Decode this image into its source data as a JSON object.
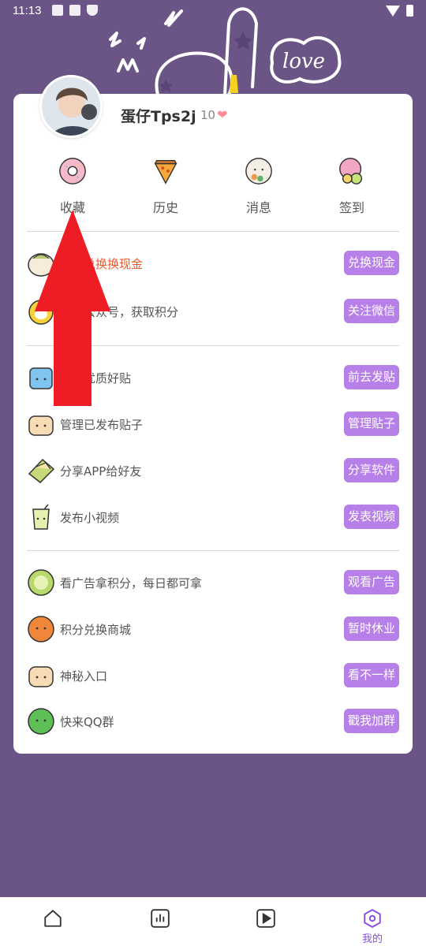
{
  "status_bar": {
    "time": "11:13"
  },
  "profile": {
    "username": "蛋仔Tps2j",
    "points": "10"
  },
  "quick_actions": [
    {
      "label": "收藏",
      "icon": "donut-icon"
    },
    {
      "label": "历史",
      "icon": "pizza-icon"
    },
    {
      "label": "消息",
      "icon": "sushi-icon"
    },
    {
      "label": "签到",
      "icon": "mochi-icon"
    }
  ],
  "group1": [
    {
      "text": "硬币兑换换现金",
      "button": "兑换现金",
      "icon": "bun-icon"
    },
    {
      "text": "微信公众号，获取积分",
      "button": "关注微信",
      "icon": "egg-icon"
    }
  ],
  "group2": [
    {
      "text": "子发优质好贴",
      "button": "前去发贴",
      "icon": "ice-cube-icon"
    },
    {
      "text": "管理已发布贴子",
      "button": "管理贴子",
      "icon": "cake-icon"
    },
    {
      "text": "分享APP给好友",
      "button": "分享软件",
      "icon": "cheese-icon"
    },
    {
      "text": "发布小视频",
      "button": "发表视频",
      "icon": "drink-icon"
    }
  ],
  "group3": [
    {
      "text": "看广告拿积分，每日都可拿",
      "button": "观看广告",
      "icon": "melon-icon"
    },
    {
      "text": "积分兑换商城",
      "button": "暂时休业",
      "icon": "orange-icon"
    },
    {
      "text": "神秘入口",
      "button": "看不一样",
      "icon": "bread-icon"
    },
    {
      "text": "快来QQ群",
      "button": "戳我加群",
      "icon": "lime-icon"
    }
  ],
  "tabs": [
    {
      "label": "",
      "icon": "home-icon"
    },
    {
      "label": "",
      "icon": "chart-icon"
    },
    {
      "label": "",
      "icon": "play-icon"
    },
    {
      "label": "我的",
      "icon": "profile-hexagon-icon"
    }
  ],
  "colors": {
    "background": "#6b5586",
    "button": "#b77fe8",
    "highlight_text": "#ea5a2c",
    "arrow": "#ee1c24",
    "active_tab": "#8a4fe0"
  }
}
